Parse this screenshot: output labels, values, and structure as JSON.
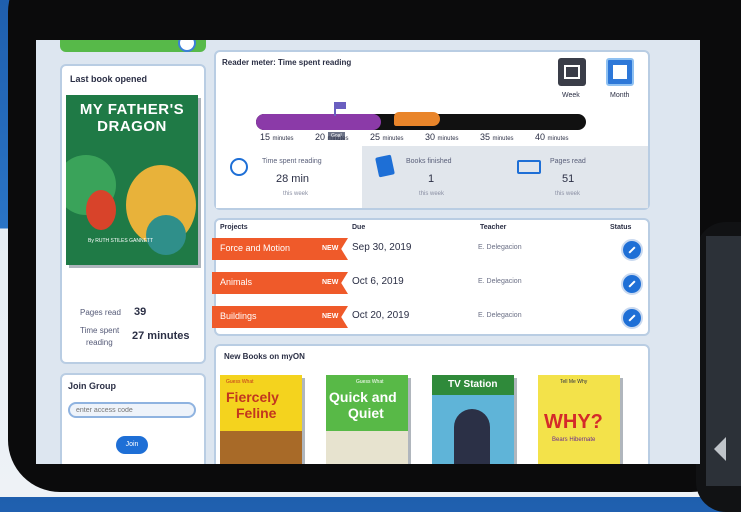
{
  "last_book": {
    "heading": "Last book opened",
    "cover_title": "MY FATHER'S DRAGON",
    "cover_author": "By RUTH STILES GANNETT",
    "pages_read_label": "Pages read",
    "pages_read_value": "39",
    "time_spent_label_1": "Time spent",
    "time_spent_label_2": "reading",
    "time_spent_value": "27 minutes"
  },
  "join_group": {
    "heading": "Join Group",
    "placeholder": "enter access code",
    "button": "Join"
  },
  "reader_meter": {
    "heading": "Reader meter: Time spent reading",
    "toggle_week": "Week",
    "toggle_month": "Month",
    "goal_label": "Goal",
    "progress_fraction": 0.38,
    "ticks": [
      {
        "num": "15",
        "unit": "minutes"
      },
      {
        "num": "20",
        "unit": "minutes"
      },
      {
        "num": "25",
        "unit": "minutes"
      },
      {
        "num": "30",
        "unit": "minutes"
      },
      {
        "num": "35",
        "unit": "minutes"
      },
      {
        "num": "40",
        "unit": "minutes"
      }
    ],
    "stats": [
      {
        "label": "Time spent reading",
        "value": "28 min",
        "period": "this week",
        "icon": "clock-icon"
      },
      {
        "label": "Books finished",
        "value": "1",
        "period": "this week",
        "icon": "book-icon"
      },
      {
        "label": "Pages read",
        "value": "51",
        "period": "this week",
        "icon": "open-book-icon"
      }
    ]
  },
  "projects": {
    "headers": {
      "projects": "Projects",
      "due": "Due",
      "teacher": "Teacher",
      "status": "Status"
    },
    "rows": [
      {
        "name": "Force and Motion",
        "tag": "NEW",
        "due": "Sep 30, 2019",
        "teacher": "E. Delegacion"
      },
      {
        "name": "Animals",
        "tag": "NEW",
        "due": "Oct 6, 2019",
        "teacher": "E. Delegacion"
      },
      {
        "name": "Buildings",
        "tag": "NEW",
        "due": "Oct 20, 2019",
        "teacher": "E. Delegacion"
      }
    ]
  },
  "new_books": {
    "heading": "New Books on myON",
    "books": [
      {
        "series": "Guess What",
        "title_1": "Fiercely",
        "title_2": "Feline"
      },
      {
        "series": "Guess What",
        "title_1": "Quick and",
        "title_2": "Quiet"
      },
      {
        "series": "",
        "title_1": "TV Station",
        "title_2": ""
      },
      {
        "series": "Tell Me Why",
        "title_1": "WHY?",
        "title_2": "Bears Hibernate"
      }
    ]
  },
  "colors": {
    "accent_blue": "#1e6fd6",
    "project_orange": "#ef5a2a",
    "progress_purple": "#8b3aa8",
    "green": "#57b949"
  }
}
